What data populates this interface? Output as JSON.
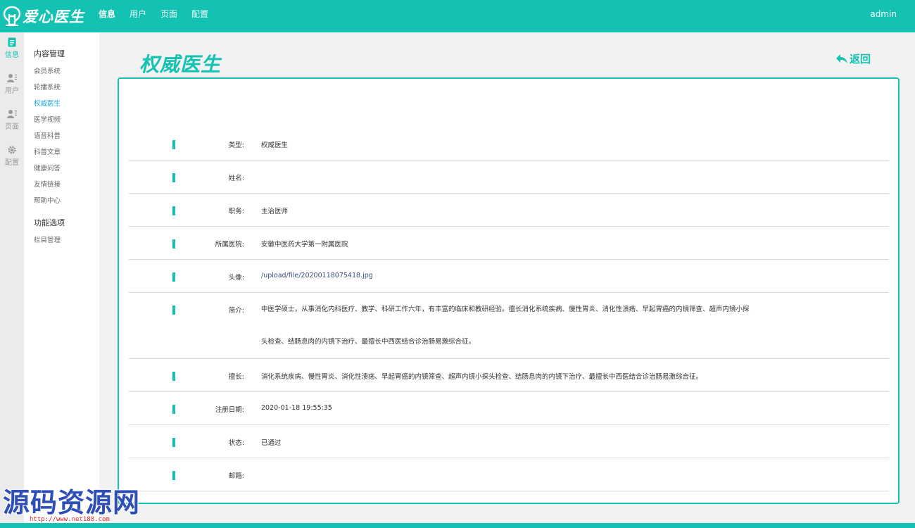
{
  "app": {
    "logo_text": "爱心医生",
    "user": "admin"
  },
  "topnav": [
    {
      "label": "信息"
    },
    {
      "label": "用户"
    },
    {
      "label": "页面"
    },
    {
      "label": "配置"
    }
  ],
  "iconbar": [
    {
      "label": "信息",
      "icon": "document-icon"
    },
    {
      "label": "用户",
      "icon": "user-list-icon"
    },
    {
      "label": "页面",
      "icon": "user-list-icon"
    },
    {
      "label": "配置",
      "icon": "gear-icon"
    }
  ],
  "menu": {
    "group1": "内容管理",
    "items1": [
      "会员系统",
      "轮播系统",
      "权威医生",
      "医学视频",
      "语音科普",
      "科普文章",
      "健康问答",
      "友情链接",
      "帮助中心"
    ],
    "group2": "功能选项",
    "items2": [
      "栏目管理"
    ]
  },
  "page": {
    "title": "权威医生",
    "back_label": "返回"
  },
  "details": [
    {
      "label": "类型:",
      "value": "权威医生"
    },
    {
      "label": "姓名:",
      "value": ""
    },
    {
      "label": "职务:",
      "value": "主治医师"
    },
    {
      "label": "所属医院:",
      "value": "安徽中医药大学第一附属医院"
    },
    {
      "label": "头像:",
      "value": "/upload/file/20200118075418.jpg"
    },
    {
      "label": "简介:",
      "value": "中医学硕士，从事消化内科医疗、教学、科研工作六年，有丰富的临床和教研经验。擅长消化系统疾病、慢性胃炎、消化性溃疡、早起胃癌的内镜筛查、超声内镜小探头检查、结肠息肉的内镜下治疗、最擅长中西医结合诊治肠易激综合征。"
    },
    {
      "label": "擅长:",
      "value": "消化系统疾病、慢性胃炎、消化性溃疡、早起胃癌的内镜筛查、超声内镜小探头检查、结肠息肉的内镜下治疗、最擅长中西医结合诊治肠易激综合征。"
    },
    {
      "label": "注册日期:",
      "value": "2020-01-18 19:55:35"
    },
    {
      "label": "状态:",
      "value": "已通过"
    },
    {
      "label": "邮箱:",
      "value": ""
    }
  ],
  "watermark": {
    "text": "源码资源网",
    "url": "http://www.net188.com"
  },
  "colors": {
    "accent": "#13c2b2",
    "active_link": "#13a6e0"
  }
}
